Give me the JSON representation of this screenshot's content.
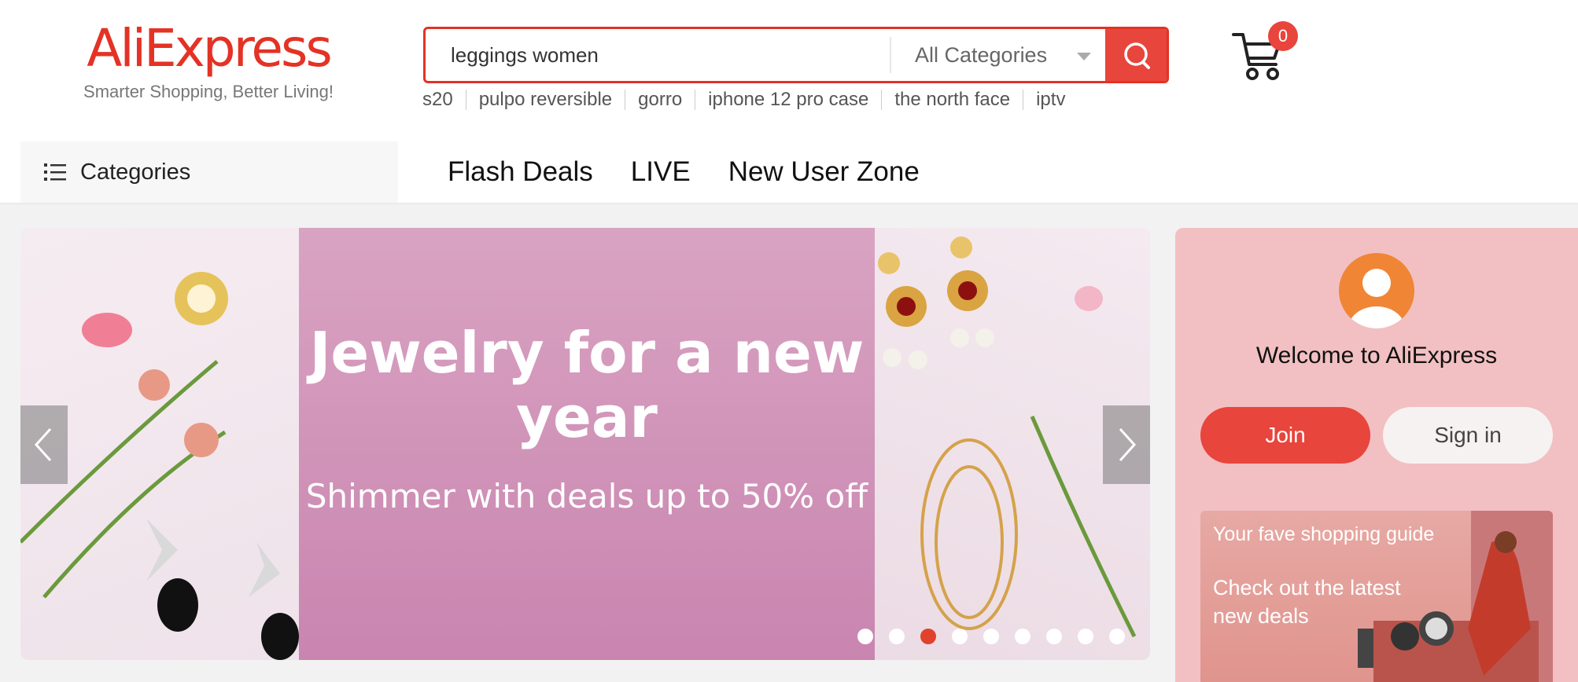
{
  "logo": {
    "text": "AliExpress",
    "tagline": "Smarter Shopping, Better Living!"
  },
  "search": {
    "value": "leggings women",
    "category": "All Categories",
    "hot_words": [
      "s20",
      "pulpo reversible",
      "gorro",
      "iphone 12 pro case",
      "the north face",
      "iptv"
    ]
  },
  "cart": {
    "count": "0"
  },
  "nav": {
    "categories_label": "Categories",
    "links": [
      "Flash Deals",
      "LIVE",
      "New User Zone"
    ]
  },
  "banner": {
    "title": "Jewelry for a new year",
    "subtitle": "Shimmer with deals up to 50% off",
    "slide_count": 9,
    "active_slide": 3
  },
  "welcome": {
    "title": "Welcome to AliExpress",
    "join_label": "Join",
    "signin_label": "Sign in",
    "guide_headline": "Your fave shopping guide",
    "guide_sub": "Check out the latest new deals"
  },
  "colors": {
    "brand": "#e43225",
    "accent": "#e8453c",
    "panel": "#f2c0c2",
    "banner_center": "#d199b9"
  },
  "icons": [
    "categories-list-icon",
    "search-icon",
    "cart-icon",
    "chevron-left-icon",
    "chevron-right-icon",
    "user-avatar-icon"
  ]
}
